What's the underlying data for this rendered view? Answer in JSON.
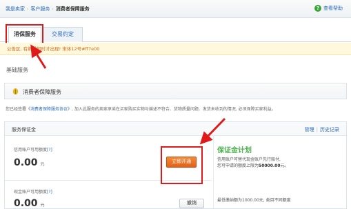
{
  "breadcrumb": {
    "items": [
      "我是卖家",
      "客户服务",
      "消费者保障服务"
    ]
  },
  "help": {
    "label": "查看帮助"
  },
  "tabs": [
    {
      "label": "消保服务"
    },
    {
      "label": "交易约定"
    }
  ],
  "notice": {
    "text": "公告区, 有新通知时才出现!  宋体12号#ff7e00"
  },
  "section": {
    "title": "基础服务"
  },
  "panel": {
    "title": "消费者保障服务"
  },
  "desc": {
    "prefix": "您已经签署《",
    "link": "消费者保障服务协议",
    "suffix": "》, 加入此服务的卖家承诺在买家购买实物与描述不符合、货物质量问题、发货未收到的情况, 必须保障买家利益。"
  },
  "deposit": {
    "title": "服务保证金",
    "manage": "管理",
    "history": "历史记录",
    "credit_label": "信用账户可用额度",
    "q": "[?]",
    "credit_amount": "0.00",
    "unit": "元",
    "activate": "立即开通",
    "cash_label": "现金账户可用额度",
    "cash_amount": "0.00",
    "cancel": "撤销"
  },
  "brand": {
    "name": "保证金计划",
    "line1": "信用账户可替代现金账户先行赔付,",
    "line2_prefix": "您可申请的额度上限为",
    "line2_amount": "50000.00",
    "line2_suffix": "元。"
  },
  "side_note": "最低缴纳额为1000.00元, 类目不同额度",
  "colors": {
    "link": "#2a6ab8",
    "notice_text": "#cc6a1a",
    "activate": "#e8701f",
    "highlight": "#e01a1a",
    "brand": "#4bb24b"
  }
}
